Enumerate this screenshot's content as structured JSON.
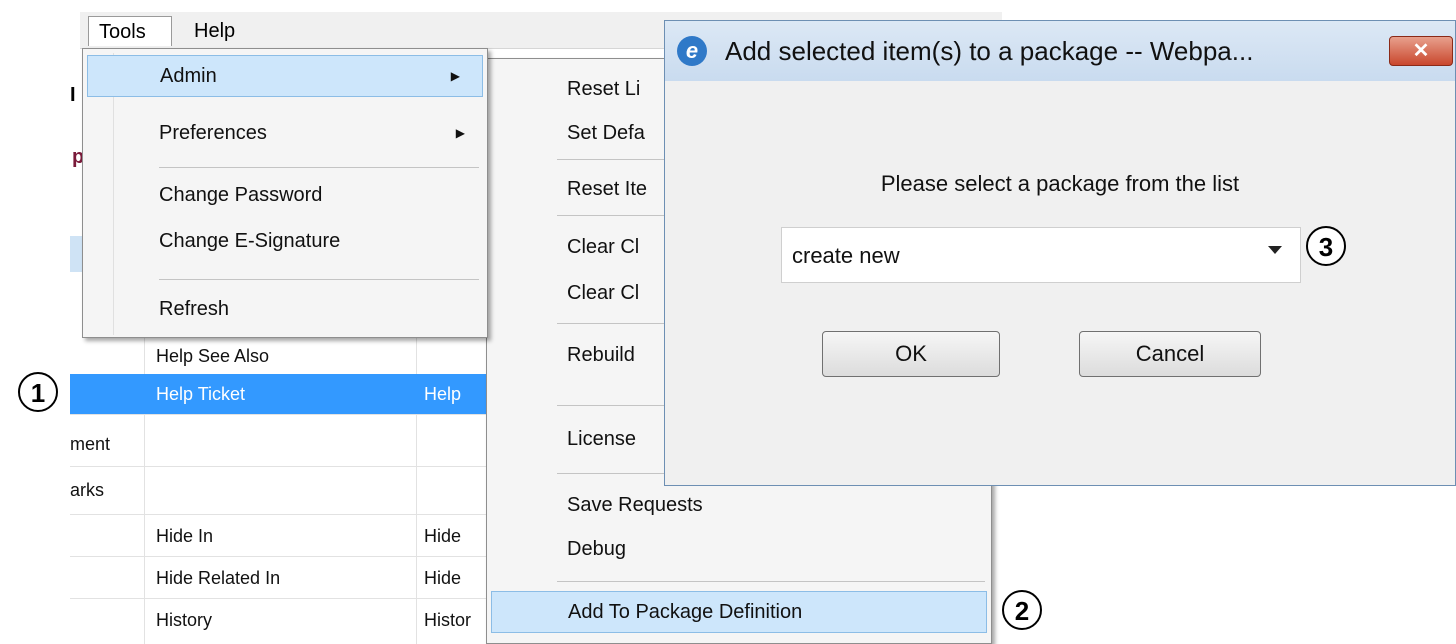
{
  "menubar": {
    "tools": "Tools",
    "help": "Help"
  },
  "background": {
    "fragments": [
      "I",
      "p"
    ],
    "rows": [
      {
        "col1": "",
        "col2": "Help See Also",
        "col3": ""
      },
      {
        "col1": "",
        "col2": "Help Ticket",
        "col3": "Help"
      },
      {
        "col1": "ment",
        "col2": "",
        "col3": ""
      },
      {
        "col1": "arks",
        "col2": "",
        "col3": ""
      },
      {
        "col1": "",
        "col2": "Hide In",
        "col3": "Hide"
      },
      {
        "col1": "",
        "col2": "Hide Related In",
        "col3": "Hide"
      },
      {
        "col1": "",
        "col2": "History",
        "col3": "Histor"
      }
    ]
  },
  "tools_menu": {
    "items": [
      "Admin",
      "Preferences",
      "Change Password",
      "Change E-Signature",
      "Refresh"
    ]
  },
  "admin_submenu": {
    "items": [
      "Reset Li",
      "Set Defa",
      "Reset Ite",
      "Clear Cl",
      "Clear Cl",
      "Rebuild",
      "License",
      "Save Requests",
      "Debug",
      "Add To Package Definition"
    ]
  },
  "dialog": {
    "title": "Add selected item(s) to a package -- Webpa...",
    "close_glyph": "✕",
    "ie_glyph": "e",
    "prompt": "Please select a package from the list",
    "select_value": "create new",
    "ok_label": "OK",
    "cancel_label": "Cancel"
  },
  "callouts": [
    "1",
    "2",
    "3"
  ],
  "colors": {
    "selection": "#3399ff",
    "menu_highlight": "#cde6fb",
    "close_red": "#c9472d"
  }
}
